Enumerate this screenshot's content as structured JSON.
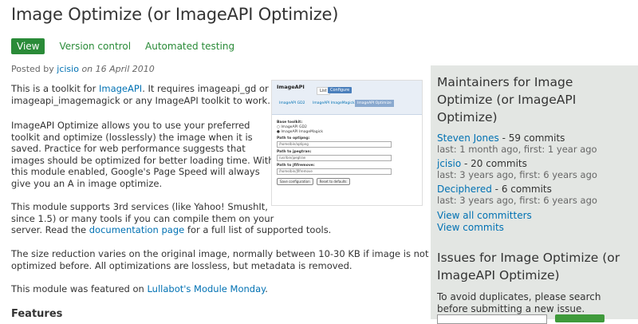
{
  "title": "Image Optimize (or ImageAPI Optimize)",
  "tabs": [
    "View",
    "Version control",
    "Automated testing"
  ],
  "posted": {
    "prefix": "Posted by",
    "author": "jcisio",
    "on": "on",
    "date": "16 April 2010"
  },
  "intro": {
    "t1": "This is a toolkit for",
    "link": "ImageAPI",
    "t2": ". It requires imageapi_gd or",
    "line2": "imageapi_imagemagick or any ImageAPI toolkit to work."
  },
  "para2": [
    "ImageAPI Optimize allows you to use your preferred",
    "toolkit and optimize (losslessly) the image when it is",
    "saved. Practice for web performance suggests that",
    "images should be optimized for better loading time. With",
    "this module enabled, Google's Page Speed will always",
    "give you an A in image optimize."
  ],
  "para3": {
    "l1": "This module supports 3rd services (like Yahoo! SmushIt,",
    "l2": "since 1.5) or many tools if you can compile them on your",
    "l3a": "server. Read the",
    "link": "documentation page",
    "l3b": "for a full list of supported tools."
  },
  "para4": [
    "The size reduction varies on the original image, normally between 10-30 KB if image is not",
    "optimized before. All optimizations are lossless, but metadata is removed."
  ],
  "para5": {
    "t1": "This module was featured on",
    "link": "Lullabot's Module Monday",
    "t2": "."
  },
  "features": "Features",
  "screenshot": {
    "heading": "ImageAPI",
    "tabs": [
      "List",
      "Configure"
    ],
    "subtabs": [
      "ImageAPI GD2",
      "ImageAPI ImageMagick",
      "ImageAPI Optimize"
    ],
    "base_label": "Base toolkit:",
    "radios": [
      "ImageAPI GD2",
      "ImageAPI ImageMagick"
    ],
    "fields": [
      {
        "label": "Path to optipng:",
        "value": "/home/bin/optipng"
      },
      {
        "label": "Path to jpegtran:",
        "value": "/usr/bin/jpegtran"
      },
      {
        "label": "Path to jfifremove:",
        "value": "/home/bin/jfifremove"
      }
    ],
    "buttons": [
      "Save configuration",
      "Reset to defaults"
    ]
  },
  "sidebar": {
    "maintainers_heading": [
      "Maintainers for Image",
      "Optimize (or ImageAPI",
      "Optimize)"
    ],
    "maintainers": [
      {
        "name": "Steven Jones",
        "commits": "- 59 commits",
        "sub": "last: 1 month ago, first: 1 year ago"
      },
      {
        "name": "jcisio",
        "commits": "- 20 commits",
        "sub": "last: 3 years ago, first: 6 years ago"
      },
      {
        "name": "Deciphered",
        "commits": "- 6 commits",
        "sub": "last: 3 years ago, first: 6 years ago"
      }
    ],
    "view_all": "View all committers",
    "view_commits": "View commits",
    "issues_heading": [
      "Issues for Image Optimize (or",
      "ImageAPI Optimize)"
    ],
    "issues_text": [
      "To avoid duplicates, please search",
      "before submitting a new issue."
    ]
  }
}
